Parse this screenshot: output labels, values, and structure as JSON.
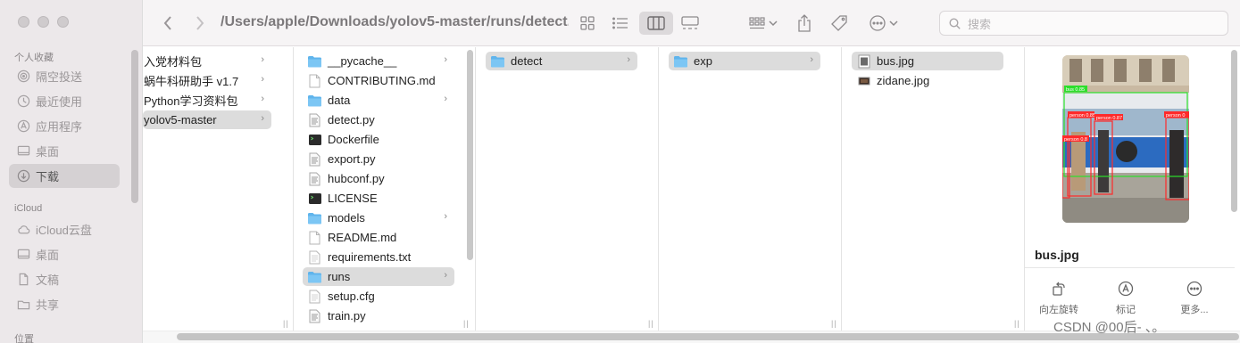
{
  "sidebar": {
    "favorites_header": "个人收藏",
    "favorites": [
      {
        "label": "隔空投送",
        "icon": "airdrop-icon"
      },
      {
        "label": "最近使用",
        "icon": "clock-icon"
      },
      {
        "label": "应用程序",
        "icon": "apps-icon"
      },
      {
        "label": "桌面",
        "icon": "desktop-icon"
      },
      {
        "label": "下载",
        "icon": "download-icon",
        "selected": true
      }
    ],
    "icloud_header": "iCloud",
    "icloud": [
      {
        "label": "iCloud云盘",
        "icon": "cloud-icon"
      },
      {
        "label": "桌面",
        "icon": "desktop-icon"
      },
      {
        "label": "文稿",
        "icon": "document-icon"
      },
      {
        "label": "共享",
        "icon": "shared-folder-icon"
      }
    ],
    "locations_header": "位置"
  },
  "toolbar": {
    "path": "/Users/apple/Downloads/yolov5-master/runs/detect...",
    "search_placeholder": "搜索"
  },
  "columns": [
    {
      "items": [
        {
          "label": "入党材料包",
          "type": "folder",
          "chevron": true
        },
        {
          "label": "蜗牛科研助手 v1.7",
          "type": "folder",
          "chevron": true
        },
        {
          "label": "Python学习资料包",
          "type": "folder",
          "chevron": true
        },
        {
          "label": "yolov5-master",
          "type": "folder",
          "chevron": true,
          "selected": true
        }
      ]
    },
    {
      "items": [
        {
          "label": "__pycache__",
          "type": "folder",
          "chevron": true
        },
        {
          "label": "CONTRIBUTING.md",
          "type": "doc"
        },
        {
          "label": "data",
          "type": "folder",
          "chevron": true
        },
        {
          "label": "detect.py",
          "type": "script"
        },
        {
          "label": "Dockerfile",
          "type": "exec"
        },
        {
          "label": "export.py",
          "type": "script"
        },
        {
          "label": "hubconf.py",
          "type": "script"
        },
        {
          "label": "LICENSE",
          "type": "exec"
        },
        {
          "label": "models",
          "type": "folder",
          "chevron": true
        },
        {
          "label": "README.md",
          "type": "doc"
        },
        {
          "label": "requirements.txt",
          "type": "text"
        },
        {
          "label": "runs",
          "type": "folder",
          "chevron": true,
          "selected": true
        },
        {
          "label": "setup.cfg",
          "type": "text"
        },
        {
          "label": "train.py",
          "type": "script"
        }
      ]
    },
    {
      "items": [
        {
          "label": "detect",
          "type": "folder",
          "chevron": true,
          "selected": true
        }
      ]
    },
    {
      "items": [
        {
          "label": "exp",
          "type": "folder",
          "chevron": true,
          "selected": true
        }
      ]
    },
    {
      "items": [
        {
          "label": "bus.jpg",
          "type": "image",
          "selected": true
        },
        {
          "label": "zidane.jpg",
          "type": "image-dark"
        }
      ]
    }
  ],
  "preview": {
    "filename": "bus.jpg",
    "actions": [
      {
        "label": "向左旋转",
        "icon": "rotate-left-icon"
      },
      {
        "label": "标记",
        "icon": "markup-icon"
      },
      {
        "label": "更多...",
        "icon": "more-icon"
      }
    ],
    "detection_labels": [
      "bus 0.85",
      "person 0.85",
      "person 0.87",
      "person 0",
      "person 0.8"
    ]
  },
  "watermark": "CSDN @00后-  、。"
}
